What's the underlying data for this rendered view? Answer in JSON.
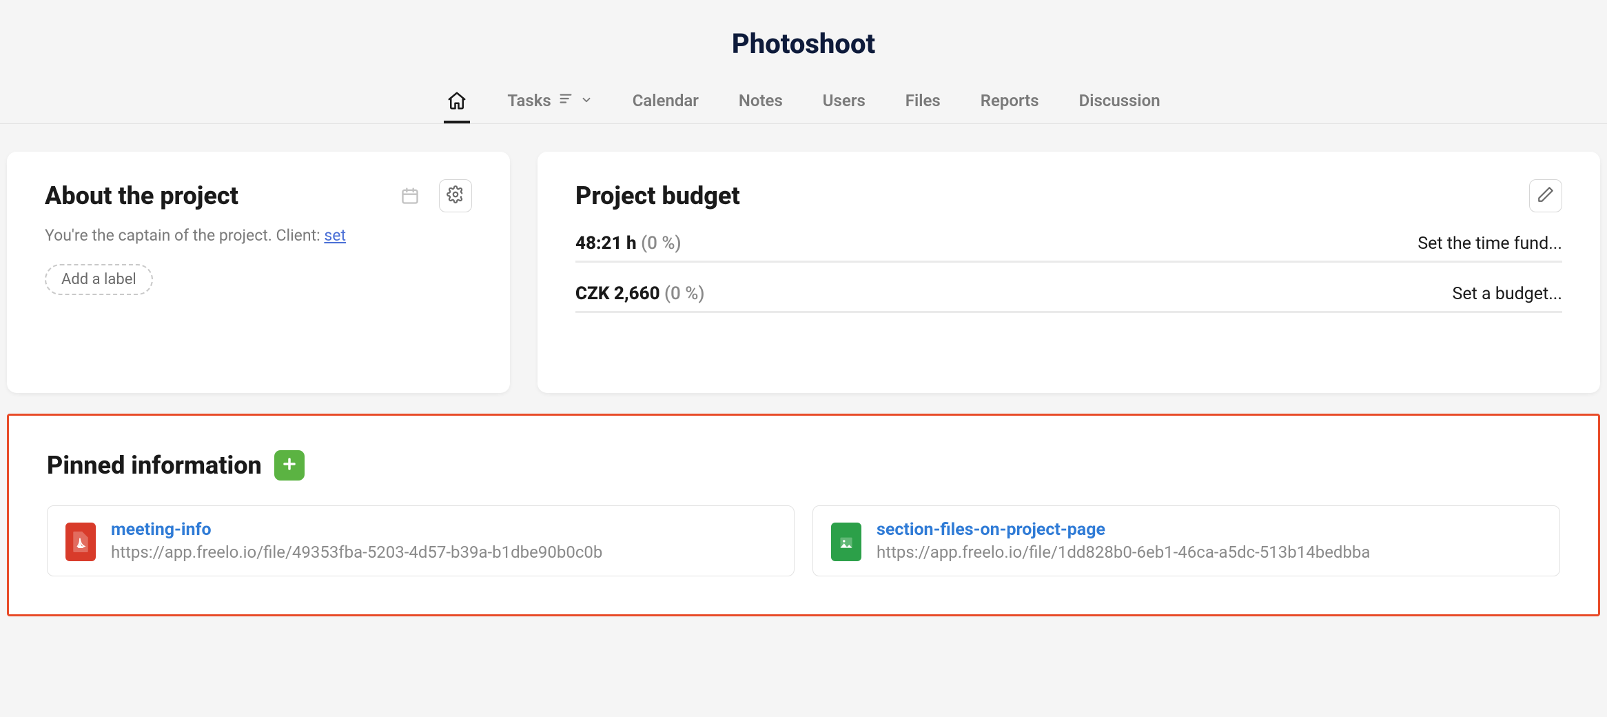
{
  "header": {
    "title": "Photoshoot",
    "tabs": {
      "home": "",
      "tasks": "Tasks",
      "calendar": "Calendar",
      "notes": "Notes",
      "users": "Users",
      "files": "Files",
      "reports": "Reports",
      "discussion": "Discussion"
    }
  },
  "about": {
    "title": "About the project",
    "caption": "You're the captain of the project. Client: ",
    "set_link": "set",
    "add_label": "Add a label"
  },
  "budget": {
    "title": "Project budget",
    "rows": [
      {
        "value": "48:21 h",
        "pct": "(0 %)",
        "action": "Set the time fund..."
      },
      {
        "value": "CZK 2,660",
        "pct": "(0 %)",
        "action": "Set a budget..."
      }
    ]
  },
  "pinned": {
    "title": "Pinned information",
    "items": [
      {
        "name": "meeting-info",
        "url": "https://app.freelo.io/file/49353fba-5203-4d57-b39a-b1dbe90b0c0b",
        "type": "pdf"
      },
      {
        "name": "section-files-on-project-page",
        "url": "https://app.freelo.io/file/1dd828b0-6eb1-46ca-a5dc-513b14bedbba",
        "type": "img"
      }
    ]
  }
}
